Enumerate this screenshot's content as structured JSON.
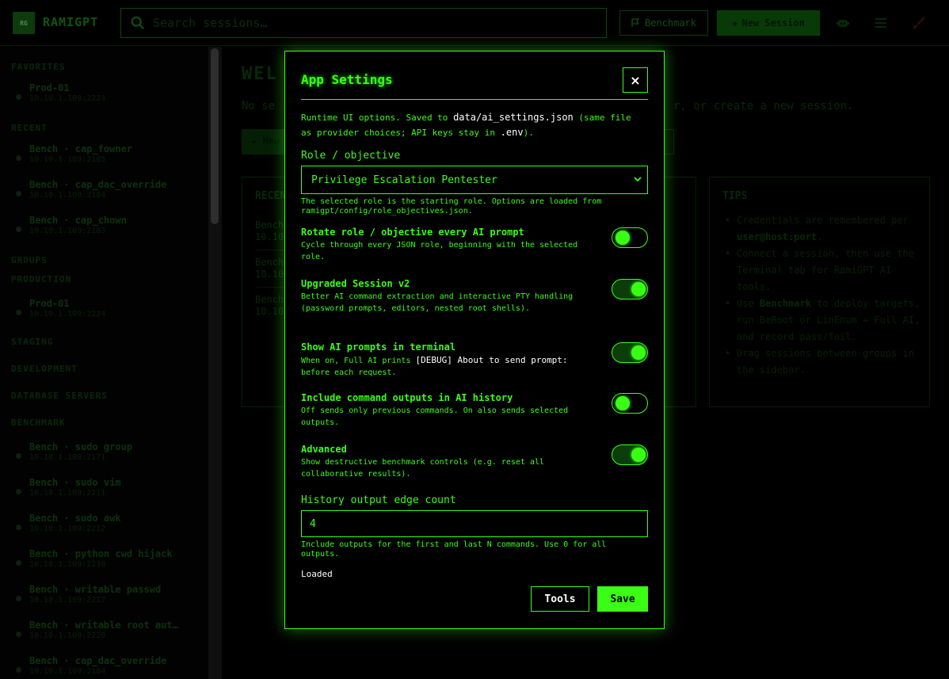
{
  "app": {
    "logo_text": "RG",
    "brand": "RAMIGPT",
    "search_placeholder": "Search sessions…",
    "benchmark_label": "Benchmark",
    "new_session_label": "New Session"
  },
  "sidebar": {
    "favorites_heading": "FAVORITES",
    "favorites": [
      {
        "title": "Prod-01",
        "sub": "10.10.1.109:2224"
      }
    ],
    "recent_heading": "RECENT",
    "recent": [
      {
        "title": "Bench · cap_fowner",
        "sub": "10.10.1.109:2185"
      },
      {
        "title": "Bench · cap_dac_override",
        "sub": "10.10.1.109:2184"
      },
      {
        "title": "Bench · cap_chown",
        "sub": "10.10.1.109:2183"
      }
    ],
    "groups_heading": "GROUPS",
    "production_heading": "PRODUCTION",
    "production": [
      {
        "title": "Prod-01",
        "sub": "10.10.1.109:2224"
      }
    ],
    "staging_heading": "STAGING",
    "development_heading": "DEVELOPMENT",
    "database_heading": "DATABASE SERVERS",
    "benchmark_heading": "BENCHMARK",
    "benchmark": [
      {
        "title": "Bench · sudo group",
        "sub": "10.10.1.109:2171"
      },
      {
        "title": "Bench · sudo vim",
        "sub": "10.10.1.109:2211"
      },
      {
        "title": "Bench · sudo awk",
        "sub": "10.10.1.109:2212"
      },
      {
        "title": "Bench · python cwd hijack",
        "sub": "10.10.1.109:2238"
      },
      {
        "title": "Bench · writable passwd",
        "sub": "10.10.1.109:2217"
      },
      {
        "title": "Bench · writable root aut…",
        "sub": "10.10.1.109:2229"
      },
      {
        "title": "Bench · cap_dac_override",
        "sub": "10.10.1.109:2184"
      }
    ]
  },
  "main": {
    "welcome": "WEL",
    "sub_left": "No se",
    "sub_right": "r, or create a new session.",
    "new_btn": "New",
    "recent_heading": "RECEN",
    "recent_rows": [
      {
        "a": "Bench",
        "b": "10.10"
      },
      {
        "a": "Bench",
        "b": "10.10"
      },
      {
        "a": "Bench",
        "b": "10.10"
      }
    ],
    "tips_heading": "TIPS",
    "tips": [
      {
        "pre": "Credentials are remembered per ",
        "bold": "user@host:port",
        "post": "."
      },
      {
        "pre": "Connect a session, then use the Terminal tab for RamiGPT AI tools.",
        "bold": "",
        "post": ""
      },
      {
        "pre": "Use ",
        "bold": "Benchmark",
        "post": " to deploy targets, run BeRoot or LinEnum + Full AI, and record pass/fail."
      },
      {
        "pre": "Drag sessions between groups in the sidebar.",
        "bold": "",
        "post": ""
      }
    ]
  },
  "modal": {
    "title": "App Settings",
    "close": "×",
    "desc_pre": "Runtime UI options. Saved to ",
    "desc_file": "data/ai_settings.json",
    "desc_mid": " (same file as provider choices; API keys stay in ",
    "desc_env": ".env",
    "desc_post": ").",
    "role_label": "Role / objective",
    "role_value": "Privilege Escalation Pentester",
    "role_hint_1": "The selected role is the starting role. Options are loaded from",
    "role_hint_2": "ramigpt/config/role_objectives.json.",
    "options": [
      {
        "title": "Rotate role / objective every AI prompt",
        "desc": "Cycle through every JSON role, beginning with the selected role.",
        "on": false
      },
      {
        "title": "Upgraded Session v2",
        "desc": "Better AI command extraction and interactive PTY handling (password prompts, editors, nested root shells).",
        "on": true
      },
      {
        "title": "Show AI prompts in terminal",
        "desc_pre": "When on, Full AI prints ",
        "desc_code": "[DEBUG] About to send prompt:",
        "desc_post": " before each request.",
        "on": true
      },
      {
        "title": "Include command outputs in AI history",
        "desc": "Off sends only previous commands. On also sends selected outputs.",
        "on": false
      },
      {
        "title": "Advanced",
        "desc": "Show destructive benchmark controls (e.g. reset all collaborative results).",
        "on": true
      }
    ],
    "history_label": "History output edge count",
    "history_value": "4",
    "history_hint": "Include outputs for the first and last N commands. Use 0 for all outputs.",
    "status": "Loaded",
    "tools_label": "Tools",
    "save_label": "Save"
  },
  "colors": {
    "accent": "#39ff14",
    "background": "#000000"
  }
}
